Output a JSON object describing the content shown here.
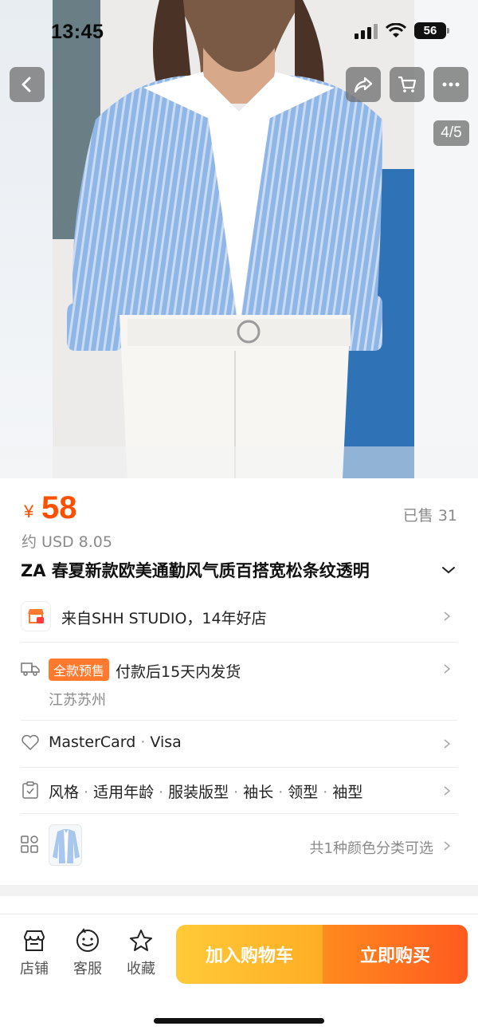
{
  "status_bar": {
    "time": "13:45",
    "battery": "56"
  },
  "gallery": {
    "indicator": "4/5"
  },
  "product": {
    "currency": "¥",
    "price": "58",
    "sold": "已售 31",
    "usd": "约 USD 8.05",
    "title": "ZA 春夏新款欧美通勤风气质百搭宽松条纹透明"
  },
  "rows": {
    "store": "来自SHH STUDIO，14年好店",
    "presale_tag": "全款预售",
    "shipping": "付款后15天内发货",
    "origin": "江苏苏州",
    "payment": [
      "MasterCard",
      "Visa"
    ],
    "params": [
      "风格",
      "适用年龄",
      "服装版型",
      "袖长",
      "领型",
      "袖型"
    ],
    "colors": "共1种颜色分类可选"
  },
  "bottom_bar": {
    "store_label": "店铺",
    "service_label": "客服",
    "favorite_label": "收藏",
    "add_to_cart": "加入购物车",
    "buy_now": "立即购买"
  },
  "colors": {
    "accent": "#ff5000",
    "cart": "#ffb52b",
    "buy": "#ff6a1f"
  },
  "icons": [
    "back-icon",
    "share-icon",
    "cart-icon",
    "more-icon",
    "store-icon",
    "truck-icon",
    "heart-icon",
    "clipboard-icon",
    "grid-icon",
    "chevron-right-icon",
    "shop-icon",
    "service-icon",
    "star-icon"
  ]
}
